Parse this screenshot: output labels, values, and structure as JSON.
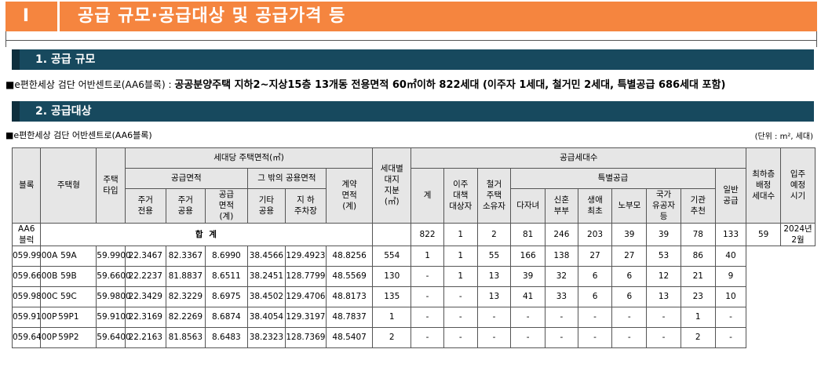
{
  "header": {
    "number": "I",
    "title": "공급 규모·공급대상 및 공급가격 등"
  },
  "section1": {
    "title": "1. 공급 규모",
    "bullet": "■",
    "project": "e편한세상 검단 어반센트로(AA6블록) : ",
    "description": "공공분양주택 지하2~지상15층 13개동 전용면적 60㎡이하 822세대 (이주자 1세대, 철거민 2세대, 특별공급 686세대 포함)"
  },
  "section2": {
    "title": "2. 공급대상",
    "bullet": "■",
    "project": "e편한세상 검단 어반센트로(AA6블록)",
    "unit": "(단위 : m², 세대)"
  },
  "table": {
    "headers": {
      "block": "블록",
      "type": "주택형",
      "typeShort": "주택\n타입",
      "areaGroup": "세대당 주택면적(㎡)",
      "supplyArea": "공급면적",
      "otherArea": "그 밖의 공용면적",
      "exclusive": "주거\n전용",
      "common": "주거\n공용",
      "supplyTotal": "공급\n면적\n(계)",
      "otherCommon": "기타\n공용",
      "parking": "지  하\n주차장",
      "contract": "계약\n면적\n(계)",
      "land": "세대별\n대지\n지분\n(㎡)",
      "supplyUnits": "공급세대수",
      "total": "계",
      "migrant": "이주\n대책\n대상자",
      "demolished": "철거\n주택\n소유자",
      "special": "특별공급",
      "multiChild": "다자녀",
      "newlywed": "신혼\n부부",
      "firstLife": "생애\n최초",
      "elderly": "노부모",
      "merit": "국가\n유공자\n등",
      "institution": "기관\n추천",
      "general": "일반\n공급",
      "lowestFloor": "최하층\n배정\n세대수",
      "moveIn": "입주\n예정\n시기"
    },
    "totalRow": {
      "label": "합 계",
      "values": [
        "822",
        "1",
        "2",
        "81",
        "246",
        "203",
        "39",
        "39",
        "78",
        "133",
        "59"
      ]
    },
    "block": "AA6\n블럭",
    "moveIn": "2024년\n2월",
    "rows": [
      {
        "type": "059.9900A",
        "typeShort": "59A",
        "cells": [
          "59.9900",
          "22.3467",
          "82.3367",
          "8.6990",
          "38.4566",
          "129.4923",
          "48.8256",
          "554",
          "1",
          "1",
          "55",
          "166",
          "138",
          "27",
          "27",
          "53",
          "86",
          "40"
        ]
      },
      {
        "type": "059.6600B",
        "typeShort": "59B",
        "cells": [
          "59.6600",
          "22.2237",
          "81.8837",
          "8.6511",
          "38.2451",
          "128.7799",
          "48.5569",
          "130",
          "-",
          "1",
          "13",
          "39",
          "32",
          "6",
          "6",
          "12",
          "21",
          "9"
        ]
      },
      {
        "type": "059.9800C",
        "typeShort": "59C",
        "cells": [
          "59.9800",
          "22.3429",
          "82.3229",
          "8.6975",
          "38.4502",
          "129.4706",
          "48.8173",
          "135",
          "-",
          "-",
          "13",
          "41",
          "33",
          "6",
          "6",
          "13",
          "23",
          "10"
        ]
      },
      {
        "type": "059.9100P",
        "typeShort": "59P1",
        "cells": [
          "59.9100",
          "22.3169",
          "82.2269",
          "8.6874",
          "38.4054",
          "129.3197",
          "48.7837",
          "1",
          "-",
          "-",
          "-",
          "-",
          "-",
          "-",
          "-",
          "-",
          "1",
          "-"
        ]
      },
      {
        "type": "059.6400P",
        "typeShort": "59P2",
        "cells": [
          "59.6400",
          "22.2163",
          "81.8563",
          "8.6483",
          "38.2323",
          "128.7369",
          "48.5407",
          "2",
          "-",
          "-",
          "-",
          "-",
          "-",
          "-",
          "-",
          "-",
          "2",
          "-"
        ]
      }
    ]
  }
}
